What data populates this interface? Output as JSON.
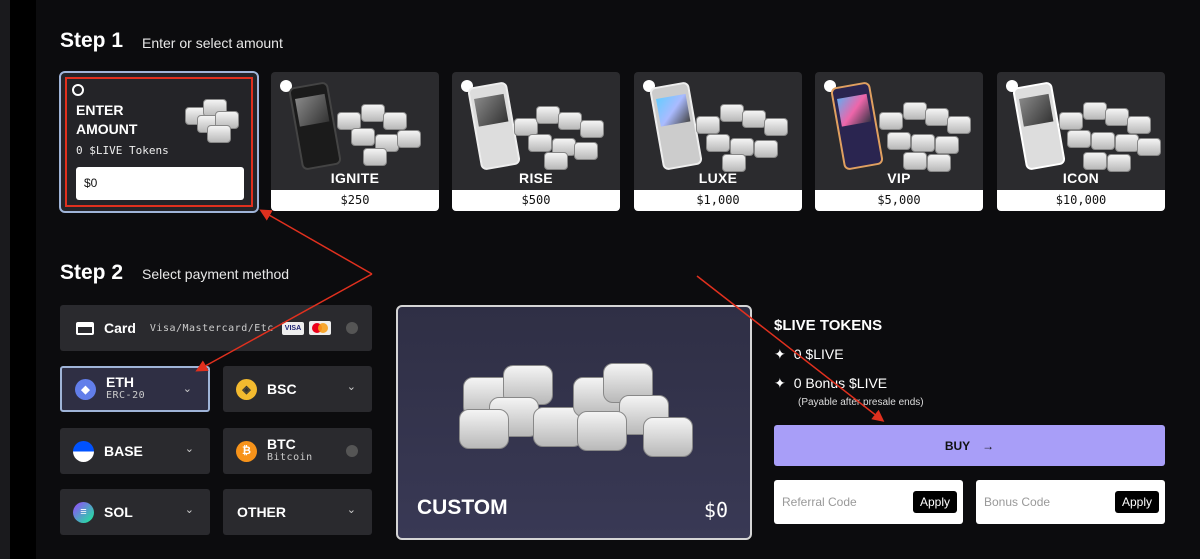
{
  "step1": {
    "title": "Step 1",
    "subtitle": "Enter or select amount",
    "enter": {
      "title_line1": "ENTER",
      "title_line2": "AMOUNT",
      "tokens": "0 $LIVE Tokens",
      "input_value": "$0"
    },
    "packages": [
      {
        "name": "IGNITE",
        "price": "$250"
      },
      {
        "name": "RISE",
        "price": "$500"
      },
      {
        "name": "LUXE",
        "price": "$1,000"
      },
      {
        "name": "VIP",
        "price": "$5,000"
      },
      {
        "name": "ICON",
        "price": "$10,000"
      }
    ]
  },
  "step2": {
    "title": "Step 2",
    "subtitle": "Select payment method",
    "methods": {
      "card": {
        "label": "Card",
        "sub": "Visa/Mastercard/Etc",
        "visa": "VISA"
      },
      "eth": {
        "label": "ETH",
        "sub": "ERC-20"
      },
      "bsc": {
        "label": "BSC"
      },
      "base": {
        "label": "BASE"
      },
      "btc": {
        "label": "BTC",
        "sub": "Bitcoin"
      },
      "sol": {
        "label": "SOL"
      },
      "other": {
        "label": "OTHER"
      }
    }
  },
  "custom": {
    "name": "CUSTOM",
    "value": "$0"
  },
  "summary": {
    "title": "$LIVE TOKENS",
    "tokens": "0 $LIVE",
    "bonus": "0 Bonus $LIVE",
    "note": "(Payable after presale ends)",
    "buy_label": "BUY",
    "referral_placeholder": "Referral Code",
    "bonus_placeholder": "Bonus Code",
    "apply_label": "Apply"
  },
  "colors": {
    "accent": "#a89ef8",
    "highlight": "#e0301e",
    "selected_border": "#9fb4d8"
  }
}
